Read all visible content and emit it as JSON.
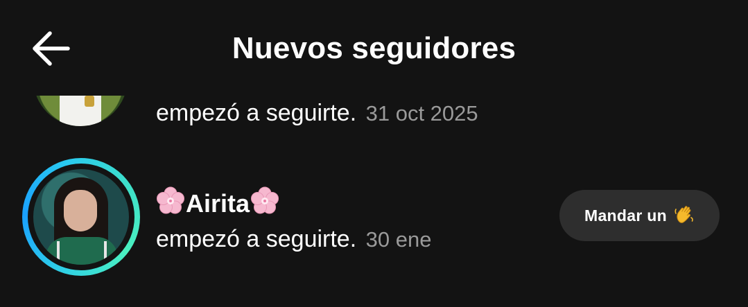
{
  "header": {
    "title": "Nuevos seguidores",
    "back_icon": "arrow-left-icon"
  },
  "notifications": [
    {
      "username": "",
      "action": "empezó a seguirte.",
      "time": "31 oct 2025"
    },
    {
      "username": "Airita",
      "username_decoration_icon": "cherry-blossom-icon",
      "action": "empezó a seguirte.",
      "time": "30 ene",
      "has_story_ring": true,
      "button_label": "Mandar un",
      "button_icon": "waving-hand-icon"
    }
  ],
  "colors": {
    "background": "#131313",
    "button_bg": "#2e2e2e",
    "muted_text": "#9a9a9a",
    "ring_start": "#1aa0ff",
    "ring_end": "#4af0c0"
  }
}
